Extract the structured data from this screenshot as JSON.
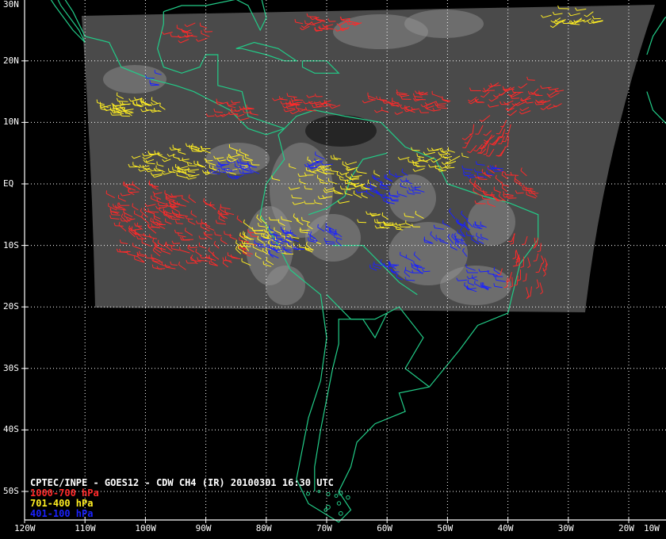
{
  "caption": {
    "title": "CPTEC/INPE - GOES12 - CDW CH4 (IR) 20100301 16:30 UTC",
    "legend": [
      {
        "label": "1000-700 hPa",
        "color": "#ff2a2a"
      },
      {
        "label": "701-400 hPa",
        "color": "#ffee22"
      },
      {
        "label": "401-100 hPa",
        "color": "#1a22ff"
      }
    ]
  },
  "map": {
    "lon_range": [
      -120,
      -10
    ],
    "lat_range": [
      -55,
      30
    ],
    "lat_ticks": [
      30,
      20,
      10,
      0,
      -10,
      -20,
      -30,
      -40,
      -50
    ],
    "lat_labels": [
      "30N",
      "20N",
      "10N",
      "EQ",
      "10S",
      "20S",
      "30S",
      "40S",
      "50S"
    ],
    "lon_ticks": [
      -120,
      -110,
      -100,
      -90,
      -80,
      -70,
      -60,
      -50,
      -40,
      -30,
      -20,
      -10
    ],
    "lon_labels": [
      "120W",
      "110W",
      "100W",
      "90W",
      "80W",
      "70W",
      "60W",
      "50W",
      "40W",
      "30W",
      "20W",
      "10W"
    ],
    "colors": {
      "background": "#000000",
      "grid": "#ffffff",
      "coastline": "#22cc88",
      "satellite_image": "#4a4a4a",
      "cloud": "#9a9a9a"
    }
  }
}
